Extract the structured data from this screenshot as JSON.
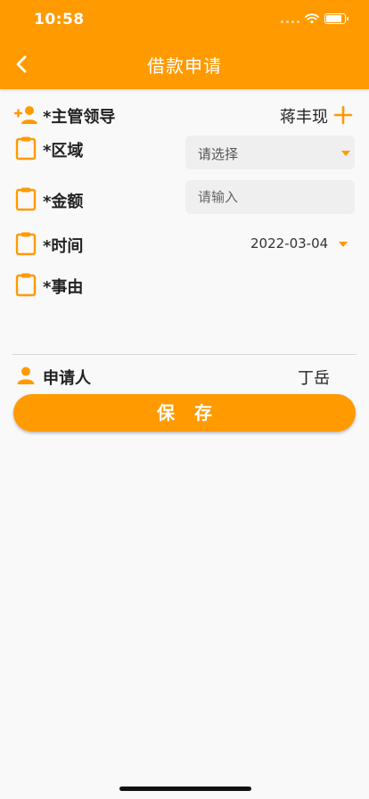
{
  "status_bar": {
    "time": "10:58"
  },
  "header": {
    "title": "借款申请"
  },
  "form": {
    "supervisor": {
      "label": "*主管领导",
      "value": "蒋丰现"
    },
    "region": {
      "label": "*区域",
      "value": "请选择"
    },
    "amount": {
      "label": "*金额",
      "placeholder": "请输入"
    },
    "time": {
      "label": "*时间",
      "value": "2022-03-04"
    },
    "reason": {
      "label": "*事由"
    }
  },
  "applicant": {
    "label": "申请人",
    "value": "丁岳"
  },
  "save_label": "保存",
  "colors": {
    "accent": "#ff9a00",
    "field_bg": "#efefef",
    "page_bg": "#f9f9f9"
  },
  "icons": {
    "back": "chevron-left-icon",
    "add_person": "person-add-icon",
    "clipboard": "clipboard-icon",
    "person": "person-icon",
    "add": "plus-icon",
    "dropdown": "caret-down-icon"
  }
}
